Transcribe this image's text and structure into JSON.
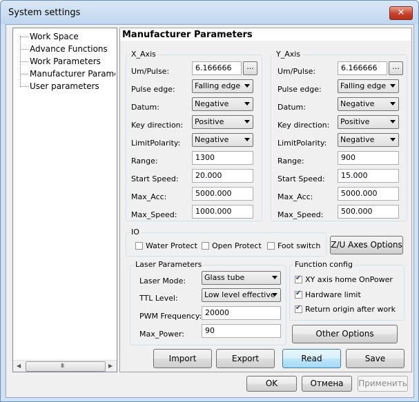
{
  "window": {
    "title": "System settings",
    "close_label": "✕"
  },
  "tree": {
    "items": [
      {
        "label": "Work Space"
      },
      {
        "label": "Advance Functions"
      },
      {
        "label": "Work Parameters"
      },
      {
        "label": "Manufacturer Paramet"
      },
      {
        "label": "User parameters"
      }
    ],
    "scroll": {
      "left_arrow": "◀",
      "right_arrow": "▶",
      "grip": "III"
    }
  },
  "panel": {
    "title": "Manufacturer Parameters"
  },
  "x_axis": {
    "group_label": "X_Axis",
    "um_pulse_label": "Um/Pulse:",
    "um_pulse_value": "6.166666",
    "pulse_edge_label": "Pulse edge:",
    "pulse_edge_value": "Falling edge",
    "datum_label": "Datum:",
    "datum_value": "Negative",
    "key_direction_label": "Key direction:",
    "key_direction_value": "Positive",
    "limit_polarity_label": "LimitPolarity:",
    "limit_polarity_value": "Negative",
    "range_label": "Range:",
    "range_value": "1300",
    "start_speed_label": "Start Speed:",
    "start_speed_value": "20.000",
    "max_acc_label": "Max_Acc:",
    "max_acc_value": "5000.000",
    "max_speed_label": "Max_Speed:",
    "max_speed_value": "1000.000",
    "ellipsis": "..."
  },
  "y_axis": {
    "group_label": "Y_Axis",
    "um_pulse_label": "Um/Pulse:",
    "um_pulse_value": "6.166666",
    "pulse_edge_label": "Pulse edge:",
    "pulse_edge_value": "Falling edge",
    "datum_label": "Datum:",
    "datum_value": "Negative",
    "key_direction_label": "Key direction:",
    "key_direction_value": "Positive",
    "limit_polarity_label": "LimitPolarity:",
    "limit_polarity_value": "Negative",
    "range_label": "Range:",
    "range_value": "900",
    "start_speed_label": "Start Speed:",
    "start_speed_value": "15.000",
    "max_acc_label": "Max_Acc:",
    "max_acc_value": "5000.000",
    "max_speed_label": "Max_Speed:",
    "max_speed_value": "500.000",
    "ellipsis": "..."
  },
  "io": {
    "group_label": "IO",
    "water_protect": "Water Protect",
    "open_protect": "Open Protect",
    "foot_switch": "Foot switch",
    "zu_axes_button": "Z/U Axes Options"
  },
  "laser": {
    "group_label": "Laser Parameters",
    "mode_label": "Laser Mode:",
    "mode_value": "Glass tube",
    "ttl_label": "TTL Level:",
    "ttl_value": "Low level effective",
    "pwm_label": "PWM Frequency:",
    "pwm_value": "20000",
    "max_power_label": "Max_Power:",
    "max_power_value": "90"
  },
  "function_config": {
    "group_label": "Function config",
    "xy_home": "XY axis home OnPower",
    "hardware_limit": "Hardware limit",
    "return_origin": "Return origin after work",
    "other_options_button": "Other Options"
  },
  "actions": {
    "import": "Import",
    "export": "Export",
    "read": "Read",
    "save": "Save"
  },
  "footer": {
    "ok": "OK",
    "cancel": "Отмена",
    "apply": "Применить"
  }
}
